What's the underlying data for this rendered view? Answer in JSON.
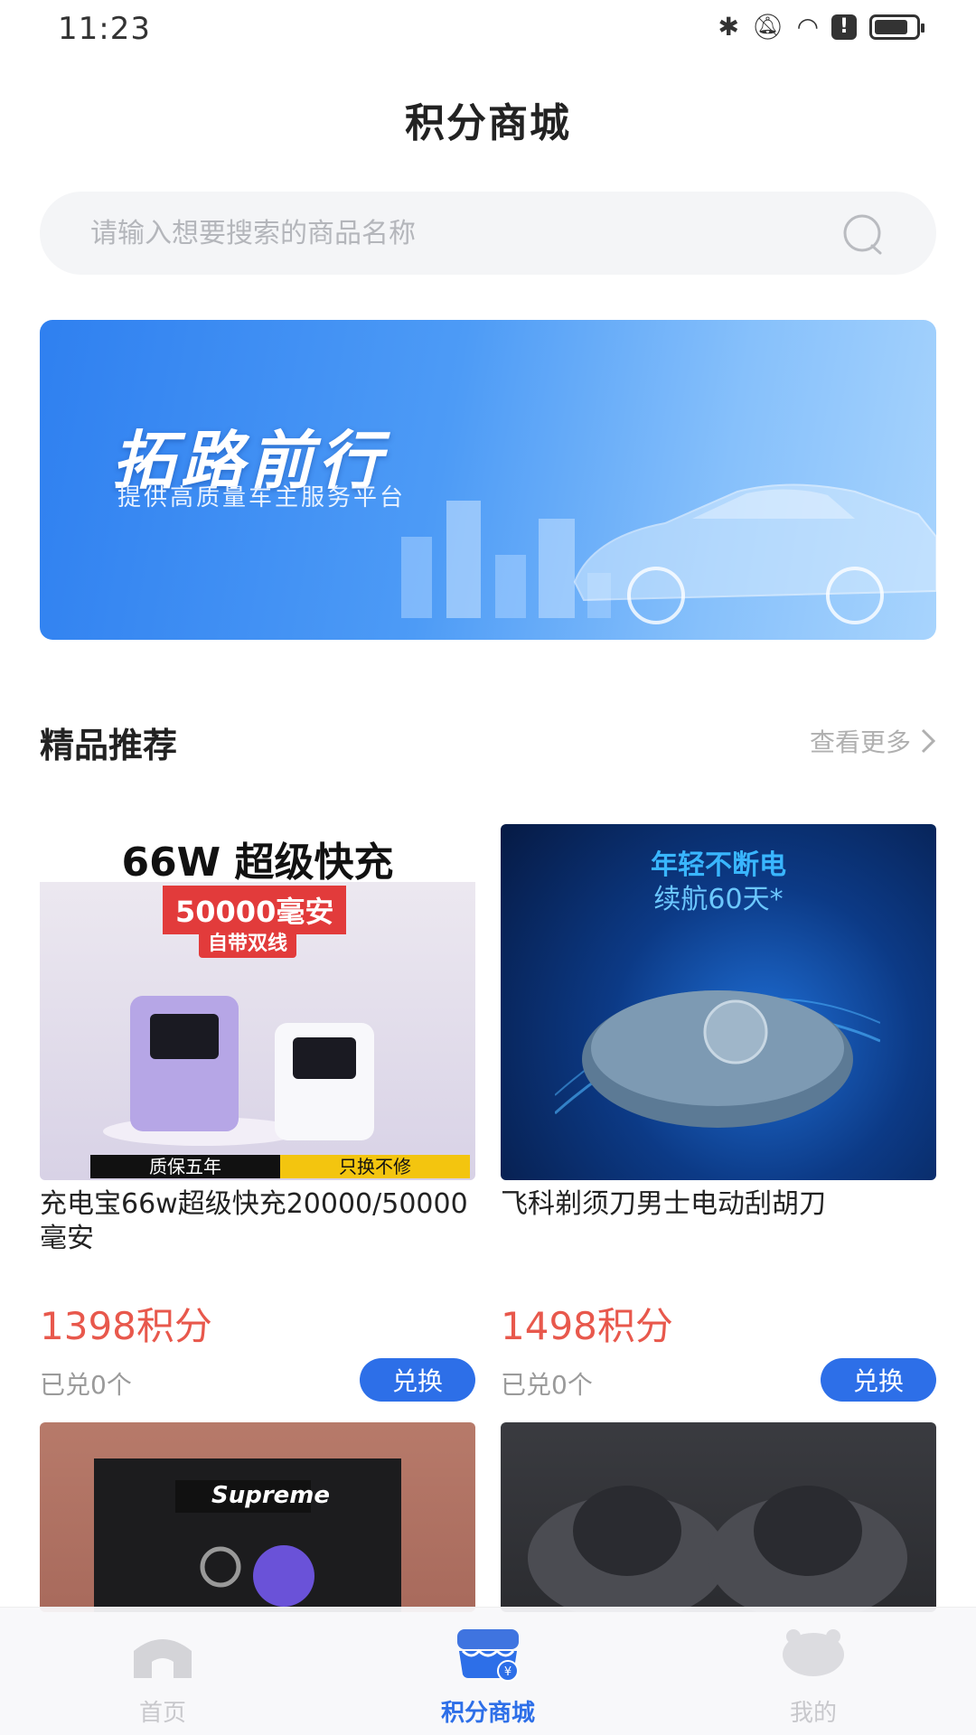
{
  "status_bar": {
    "time": "11:23",
    "icons": [
      "bluetooth-icon",
      "mute-bell-icon",
      "wifi-icon",
      "alert-icon",
      "battery-icon"
    ]
  },
  "header": {
    "title": "积分商城"
  },
  "search": {
    "placeholder": "请输入想要搜索的商品名称",
    "value": ""
  },
  "banner": {
    "title": "拓路前行",
    "subtitle": "提供高质量车主服务平台"
  },
  "section": {
    "title": "精品推荐",
    "more_label": "查看更多"
  },
  "products": [
    {
      "name": "充电宝66w超级快充20000/50000毫安",
      "price": "1398积分",
      "sold": "已兑0个",
      "button": "兑换",
      "image_text": {
        "headline": "66W 超级快充",
        "capacity": "50000毫安",
        "tag": "自带双线",
        "strip_left": "质保五年",
        "strip_right": "只换不修"
      }
    },
    {
      "name": "飞科剃须刀男士电动刮胡刀",
      "price": "1498积分",
      "sold": "已兑0个",
      "button": "兑换",
      "image_text": {
        "line1": "年轻不断电",
        "line2": "续航60天*"
      }
    },
    {
      "image_text": {
        "brand": "Supreme"
      }
    },
    {}
  ],
  "bottom_nav": [
    {
      "label": "首页",
      "icon": "home-icon",
      "active": false
    },
    {
      "label": "积分商城",
      "icon": "points-mall-icon",
      "active": true
    },
    {
      "label": "我的",
      "icon": "profile-icon",
      "active": false
    }
  ],
  "colors": {
    "accent": "#2d6fe8",
    "price": "#e8584c",
    "muted": "#9a9a9a"
  }
}
